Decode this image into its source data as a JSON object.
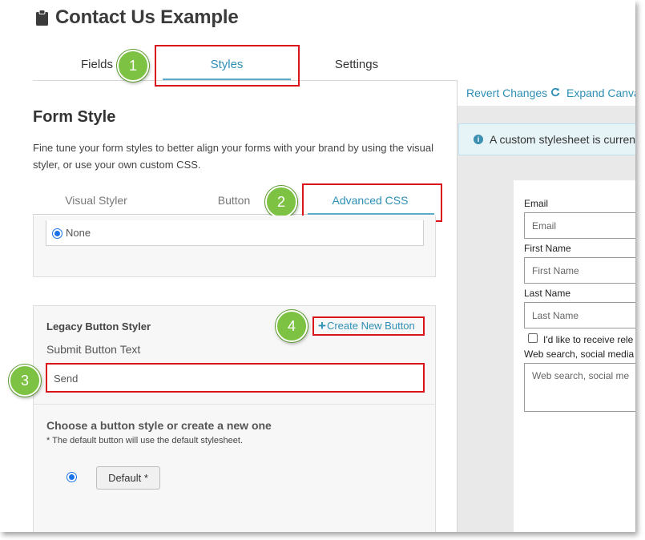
{
  "page_title": "Contact Us Example",
  "main_tabs": [
    {
      "label": "Fields"
    },
    {
      "label": "Styles"
    },
    {
      "label": "Settings"
    }
  ],
  "callouts": [
    "1",
    "2",
    "3",
    "4"
  ],
  "form_style": {
    "heading": "Form Style",
    "description": "Fine tune your form styles to better align your forms with your brand by using the visual styler, or use your own custom CSS.",
    "sub_tabs": [
      {
        "label": "Visual Styler"
      },
      {
        "label": "Button"
      },
      {
        "label": "Advanced CSS"
      }
    ],
    "selected_option": "None"
  },
  "legacy_button": {
    "heading": "Legacy Button Styler",
    "create_new_label": "Create New Button",
    "submit_text_label": "Submit Button Text",
    "submit_text_value": "Send",
    "choose_heading": "Choose a button style or create a new one",
    "choose_note": "* The default button will use the default stylesheet.",
    "default_button_label": "Default *"
  },
  "preview": {
    "revert_label": "Revert Changes",
    "expand_label": "Expand Canva",
    "info_text": "A custom stylesheet is current",
    "fields": [
      {
        "label": "Email",
        "placeholder": "Email"
      },
      {
        "label": "First Name",
        "placeholder": "First Name"
      },
      {
        "label": "Last Name",
        "placeholder": "Last Name"
      }
    ],
    "checkbox_label": "I'd like to receive rele",
    "textarea_label": "Web search, social media",
    "textarea_placeholder": "Web search, social me"
  },
  "colors": {
    "accent": "#2e8fb5",
    "callout_green": "#7dc243",
    "highlight_red": "#d9141b"
  }
}
